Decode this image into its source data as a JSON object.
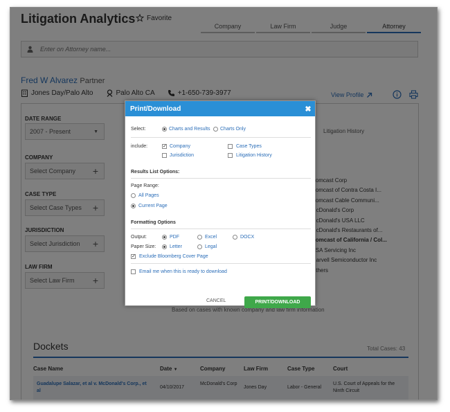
{
  "app": {
    "title": "Litigation Analytics",
    "favorite_label": "Favorite"
  },
  "tabs": [
    "Company",
    "Law Firm",
    "Judge",
    "Attorney"
  ],
  "active_tab": "Attorney",
  "search": {
    "placeholder": "Enter on Attorney name..."
  },
  "attorney": {
    "name": "Fred W Alvarez",
    "role": "Partner",
    "firm": "Jones Day/Palo Alto",
    "location": "Palo Alto CA",
    "phone": "+1-650-739-3977",
    "view_profile": "View Profile"
  },
  "filters": {
    "date_range": {
      "label": "DATE RANGE",
      "value": "2007 - Present"
    },
    "company": {
      "label": "COMPANY",
      "placeholder": "Select Company"
    },
    "case_type": {
      "label": "CASE TYPE",
      "placeholder": "Select Case Types"
    },
    "jurisdiction": {
      "label": "JURISDICTION",
      "placeholder": "Select Jurisdiction"
    },
    "law_firm": {
      "label": "LAW FIRM",
      "placeholder": "Select Law Firm"
    }
  },
  "right_panel": {
    "tab": "Litigation History",
    "companies": [
      "Comcast Corp",
      "Comcast of Contra Costa I...",
      "Comcast Cable Communi...",
      "McDonald's Corp",
      "McDonald's USA LLC",
      "McDonald's Restaurants of...",
      "Comcast of California / Col...",
      "USA Servicing Inc",
      "Marvell Semiconductor Inc",
      "Others"
    ],
    "bold_index": 6,
    "footnote": "Based on cases with known company and law firm information"
  },
  "dockets": {
    "title": "Dockets",
    "total": "Total Cases: 43",
    "columns": [
      "Case Name",
      "Date",
      "Company",
      "Law Firm",
      "Case Type",
      "Court"
    ],
    "rows": [
      {
        "case_name": "Guadalupe Salazar, et al v. McDonald's Corp., et al",
        "date": "04/10/2017",
        "company": "McDonald's Corp",
        "law_firm": "Jones Day",
        "case_type": "Labor - General",
        "court": "U.S. Court of Appeals for the Ninth Circuit"
      }
    ]
  },
  "modal": {
    "title": "Print/Download",
    "select_label": "Select:",
    "select_options": [
      "Charts and Results",
      "Charts Only"
    ],
    "include_label": "include:",
    "include_options": [
      {
        "label": "Company",
        "checked": true
      },
      {
        "label": "Case Types",
        "checked": false
      },
      {
        "label": "Jurisdiction",
        "checked": false
      },
      {
        "label": "Litigation History",
        "checked": false
      }
    ],
    "results_heading": "Results List Options:",
    "page_range_label": "Page Range:",
    "page_range_options": [
      "All Pages",
      "Current Page"
    ],
    "formatting_heading": "Formatting Options",
    "output_label": "Output:",
    "output_options": [
      "PDF",
      "Excel",
      "DOCX"
    ],
    "paper_label": "Paper Size:",
    "paper_options": [
      "Letter",
      "Legal"
    ],
    "exclude_cover": "Exclude Bloomberg Cover Page",
    "email_me": "Email me when this is ready to download",
    "cancel": "CANCEL",
    "submit": "PRINT/DOWNLOAD"
  }
}
